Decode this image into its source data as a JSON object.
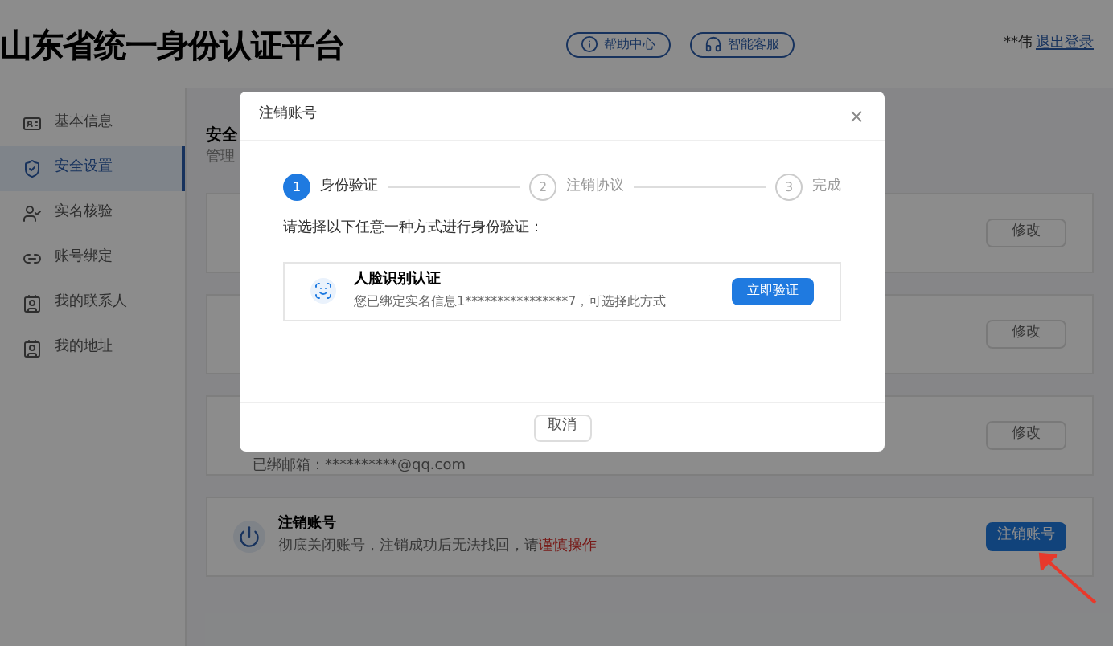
{
  "header": {
    "title": "山东省统一身份认证平台",
    "buttons": [
      {
        "label": "帮助中心",
        "kind": "info"
      },
      {
        "label": "智能客服",
        "kind": "service"
      }
    ],
    "user": "**伟",
    "logout": "退出登录"
  },
  "sidebar": {
    "items": [
      {
        "label": "基本信息",
        "selected": false,
        "kind": "profile"
      },
      {
        "label": "安全设置",
        "selected": true,
        "kind": "security"
      },
      {
        "label": "实名核验",
        "selected": false,
        "kind": "person"
      },
      {
        "label": "账号绑定",
        "selected": false,
        "kind": "link"
      },
      {
        "label": "我的联系人",
        "selected": false,
        "kind": "contact"
      },
      {
        "label": "我的地址",
        "selected": false,
        "kind": "contact"
      }
    ]
  },
  "content": {
    "title": "安全",
    "subtitle": "管理",
    "cards": [
      {
        "button": "修改",
        "primary": false
      },
      {
        "button": "修改",
        "primary": false
      },
      {
        "detail": "已绑邮箱：**********@qq.com",
        "button": "修改",
        "primary": false
      },
      {
        "title": "注销账号",
        "description": "彻底关闭账号，注销成功后无法找回，请",
        "warning": "谨慎操作",
        "button": "注销账号",
        "primary": true
      }
    ]
  },
  "dialog": {
    "title": "注销账号",
    "steps": [
      {
        "number": "1",
        "label": "身份验证",
        "selected": true
      },
      {
        "number": "2",
        "label": "注销协议",
        "selected": false
      },
      {
        "number": "3",
        "label": "完成",
        "selected": false
      }
    ],
    "prompt": "请选择以下任意一种方式进行身份验证：",
    "method": {
      "title": "人脸识别认证",
      "description": "您已绑定实名信息1****************7，可选择此方式",
      "button": "立即验证"
    },
    "cancel": "取消"
  }
}
